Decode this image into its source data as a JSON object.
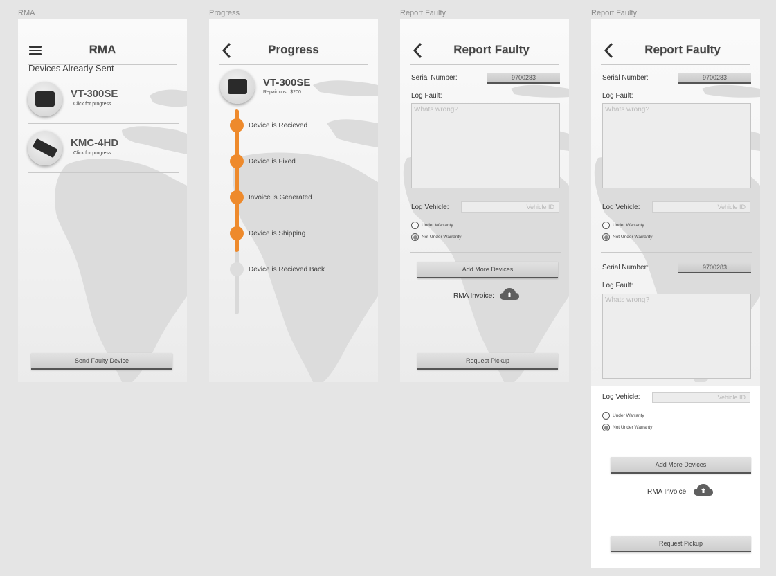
{
  "frames": {
    "rma": "RMA",
    "progress": "Progress",
    "report1": "Report Faulty",
    "report2": "Report Faulty"
  },
  "rma_screen": {
    "title": "RMA",
    "subtitle": "Devices Already Sent",
    "devices": [
      {
        "name": "VT-300SE",
        "hint": "Click for progress"
      },
      {
        "name": "KMC-4HD",
        "hint": "Click for progress"
      }
    ],
    "send_button": "Send Faulty Device"
  },
  "progress_screen": {
    "title": "Progress",
    "device_name": "VT-300SE",
    "repair_cost": "Repair cost: $200",
    "steps": [
      {
        "label": "Device is Recieved",
        "done": true
      },
      {
        "label": "Device is Fixed",
        "done": true
      },
      {
        "label": "Invoice is Generated",
        "done": true
      },
      {
        "label": "Device is Shipping",
        "done": true
      },
      {
        "label": "Device is Recieved Back",
        "done": false
      }
    ],
    "accent_color": "#ee8a2c"
  },
  "report_screen": {
    "title": "Report Faulty",
    "serial_label": "Serial Number:",
    "serial_value": "9700283",
    "log_fault_label": "Log Fault:",
    "log_fault_placeholder": "Whats wrong?",
    "log_vehicle_label": "Log Vehicle:",
    "vehicle_placeholder": "Vehicle ID",
    "under_warranty": "Under Warranty",
    "not_under_warranty": "Not Under Warranty",
    "selected_warranty": "Not Under Warranty",
    "add_more_button": "Add More Devices",
    "invoice_label": "RMA Invoice:",
    "request_button": "Request Pickup",
    "upload_icon": "cloud-upload-icon"
  }
}
